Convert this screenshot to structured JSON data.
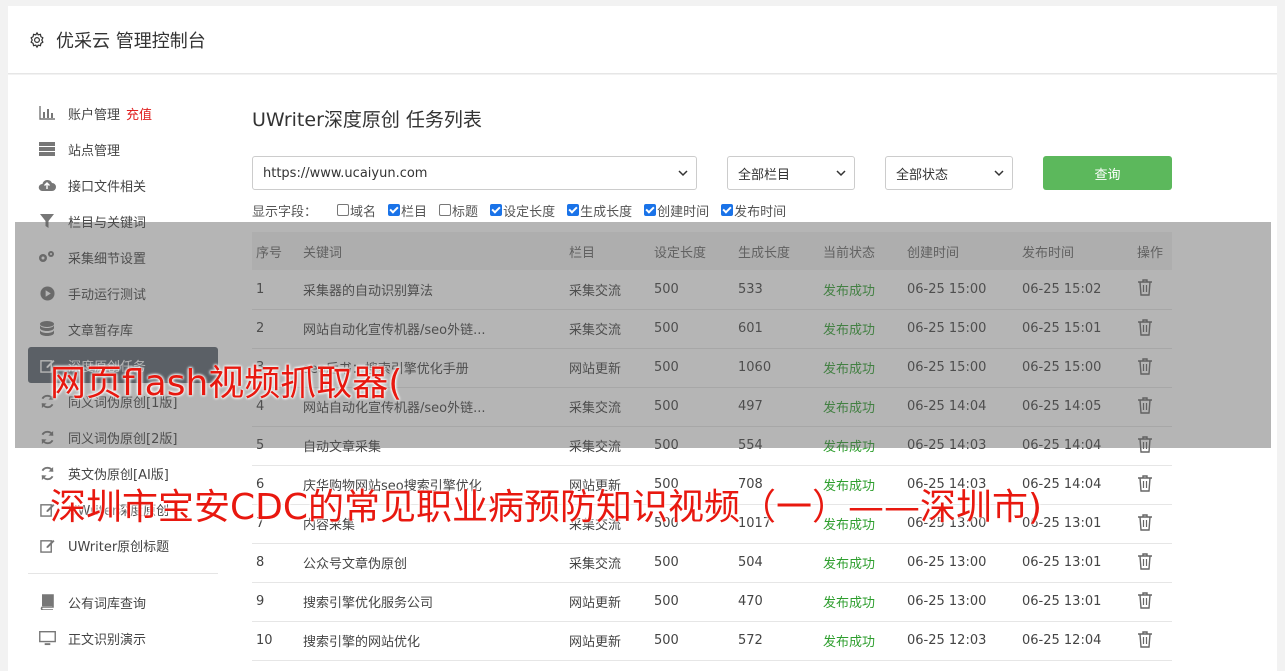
{
  "header": {
    "title": "优采云 管理控制台",
    "icon": "gear-icon"
  },
  "sidebar": {
    "items": [
      {
        "label": "账户管理",
        "icon": "bar-chart-icon",
        "extra": "充值"
      },
      {
        "label": "站点管理",
        "icon": "server-icon"
      },
      {
        "label": "接口文件相关",
        "icon": "cloud-upload-icon"
      },
      {
        "label": "栏目与关键词",
        "icon": "filter-icon"
      },
      {
        "label": "采集细节设置",
        "icon": "gears-icon"
      },
      {
        "label": "手动运行测试",
        "icon": "play-circle-icon"
      },
      {
        "label": "文章暂存库",
        "icon": "database-icon"
      },
      {
        "label": "深度原创任务",
        "icon": "edit-icon",
        "active": true
      },
      {
        "label": "同义词伪原创[1版]",
        "icon": "refresh-icon"
      },
      {
        "label": "同义词伪原创[2版]",
        "icon": "refresh-icon"
      },
      {
        "label": "英文伪原创[AI版]",
        "icon": "refresh-icon"
      },
      {
        "label": "UWriter深度原创",
        "icon": "edit-icon"
      },
      {
        "label": "UWriter原创标题",
        "icon": "edit-icon"
      },
      {
        "label": "公有词库查询",
        "icon": "book-icon"
      },
      {
        "label": "正文识别演示",
        "icon": "monitor-icon"
      }
    ]
  },
  "main": {
    "title": "UWriter深度原创 任务列表",
    "site_select": "https://www.ucaiyun.com",
    "column_select": "全部栏目",
    "status_select": "全部状态",
    "query_button": "查询",
    "fields_label": "显示字段：",
    "fields": [
      {
        "label": "域名",
        "checked": false
      },
      {
        "label": "栏目",
        "checked": true
      },
      {
        "label": "标题",
        "checked": false
      },
      {
        "label": "设定长度",
        "checked": true
      },
      {
        "label": "生成长度",
        "checked": true
      },
      {
        "label": "创建时间",
        "checked": true
      },
      {
        "label": "发布时间",
        "checked": true
      }
    ],
    "table": {
      "headers": [
        "序号",
        "关键词",
        "栏目",
        "设定长度",
        "生成长度",
        "当前状态",
        "创建时间",
        "发布时间",
        "操作"
      ],
      "rows": [
        [
          "1",
          "采集器的自动识别算法",
          "采集交流",
          "500",
          "533",
          "发布成功",
          "06-25 15:00",
          "06-25 15:02"
        ],
        [
          "2",
          "网站自动化宣传机器/seo外链...",
          "采集交流",
          "500",
          "601",
          "发布成功",
          "06-25 15:00",
          "06-25 15:01"
        ],
        [
          "3",
          "seo后书：搜索引擎优化手册",
          "网站更新",
          "500",
          "1060",
          "发布成功",
          "06-25 15:00",
          "06-25 15:00"
        ],
        [
          "4",
          "网站自动化宣传机器/seo外链...",
          "采集交流",
          "500",
          "497",
          "发布成功",
          "06-25 14:04",
          "06-25 14:05"
        ],
        [
          "5",
          "自动文章采集",
          "采集交流",
          "500",
          "554",
          "发布成功",
          "06-25 14:03",
          "06-25 14:04"
        ],
        [
          "6",
          "庆华购物网站seo搜索引擎优化",
          "网站更新",
          "500",
          "708",
          "发布成功",
          "06-25 14:03",
          "06-25 14:04"
        ],
        [
          "7",
          "内容采集",
          "采集交流",
          "500",
          "1017",
          "发布成功",
          "06-25 13:00",
          "06-25 13:01"
        ],
        [
          "8",
          "公众号文章伪原创",
          "采集交流",
          "500",
          "504",
          "发布成功",
          "06-25 13:00",
          "06-25 13:01"
        ],
        [
          "9",
          "搜索引擎优化服务公司",
          "网站更新",
          "500",
          "470",
          "发布成功",
          "06-25 13:00",
          "06-25 13:01"
        ],
        [
          "10",
          "搜索引擎的网站优化",
          "网站更新",
          "500",
          "572",
          "发布成功",
          "06-25 12:03",
          "06-25 12:04"
        ]
      ]
    }
  },
  "watermark": {
    "line1": "网页flash视频抓取器(",
    "line2": "深圳市宝安CDC的常见职业病预防知识视频（一）——深圳市)"
  },
  "colors": {
    "accent_green": "#5cb85c",
    "status_green": "#2e9e2e",
    "recharge_red": "#e02020",
    "watermark_red": "#e8180f"
  }
}
